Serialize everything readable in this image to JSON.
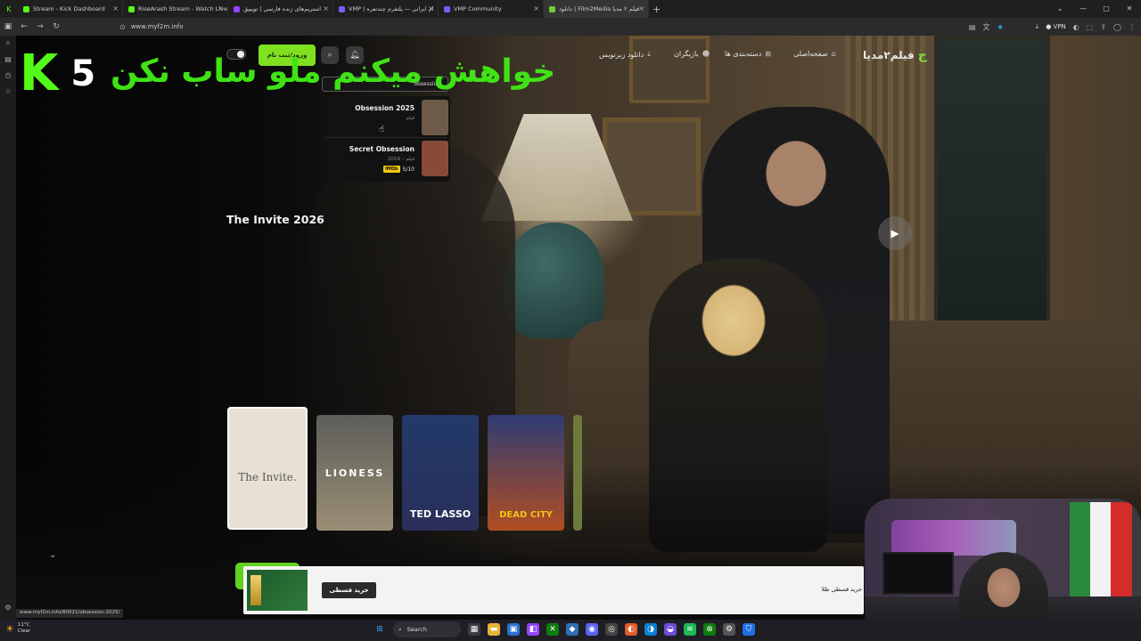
{
  "browser": {
    "tabs": [
      {
        "label": "Stream - Kick Dashboard",
        "color": "#53fc18",
        "active": false
      },
      {
        "label": "RiseArash Stream - Watch Live",
        "color": "#53fc18",
        "active": false
      },
      {
        "label": "استریم‌های زنده فارسی | تویییق",
        "color": "#9146ff",
        "active": false
      },
      {
        "label": "VMP | ‌ام ایرانی — پلتفرم چندنفره",
        "color": "#7a5cff",
        "active": false
      },
      {
        "label": "VMP Community",
        "color": "#7a5cff",
        "active": false
      },
      {
        "label": "دانلود | Film2Media فیلم ۲ مدیا",
        "color": "#6fd13a",
        "active": true
      }
    ],
    "new_tab": "+",
    "url": "www.myf2m.info",
    "vpn_label": "VPN",
    "status_url": "www.myf2m.info/80021/obsession-2025/"
  },
  "site": {
    "logo_text": "فیلم۲مدیا",
    "nav": [
      {
        "label": "صفحه‌اصلی",
        "icon": "home-icon"
      },
      {
        "label": "دسته‌بندی ها",
        "icon": "grid-icon"
      },
      {
        "label": "بازیگران",
        "icon": "users-icon"
      },
      {
        "label": "دانلود زیرنویس",
        "icon": "download-icon"
      }
    ],
    "login_label": "ورود/ثبت نام",
    "search": {
      "value": "obsession",
      "results": [
        {
          "title": "Obsession 2025",
          "type": "فیلم",
          "thumb_color": "#6e5a48"
        },
        {
          "title": "Secret Obsession",
          "meta": "فیلم – 2019",
          "rating": "5/10",
          "rating_badge": "IMDb",
          "thumb_color": "#8a4a3a"
        }
      ]
    },
    "hero_title": "The Invite 2026",
    "posters": [
      {
        "caption": "The Invite.",
        "active": true
      },
      {
        "caption": "LIONESS",
        "active": false
      },
      {
        "caption": "TED LASSO",
        "active": false
      },
      {
        "caption": "DEAD CITY",
        "active": false
      },
      {
        "caption": "",
        "active": false
      }
    ],
    "ad": {
      "button_label": "خرید قسطی",
      "text": "خرید قسطی طلا"
    }
  },
  "stream_overlay": {
    "kick_number": "5",
    "caption": "خواهش میکنم ملو ساب نکن",
    "accent_color": "#53fc18"
  },
  "taskbar": {
    "weather_temp": "11°C",
    "weather_desc": "Clear",
    "search_label": "Search"
  }
}
